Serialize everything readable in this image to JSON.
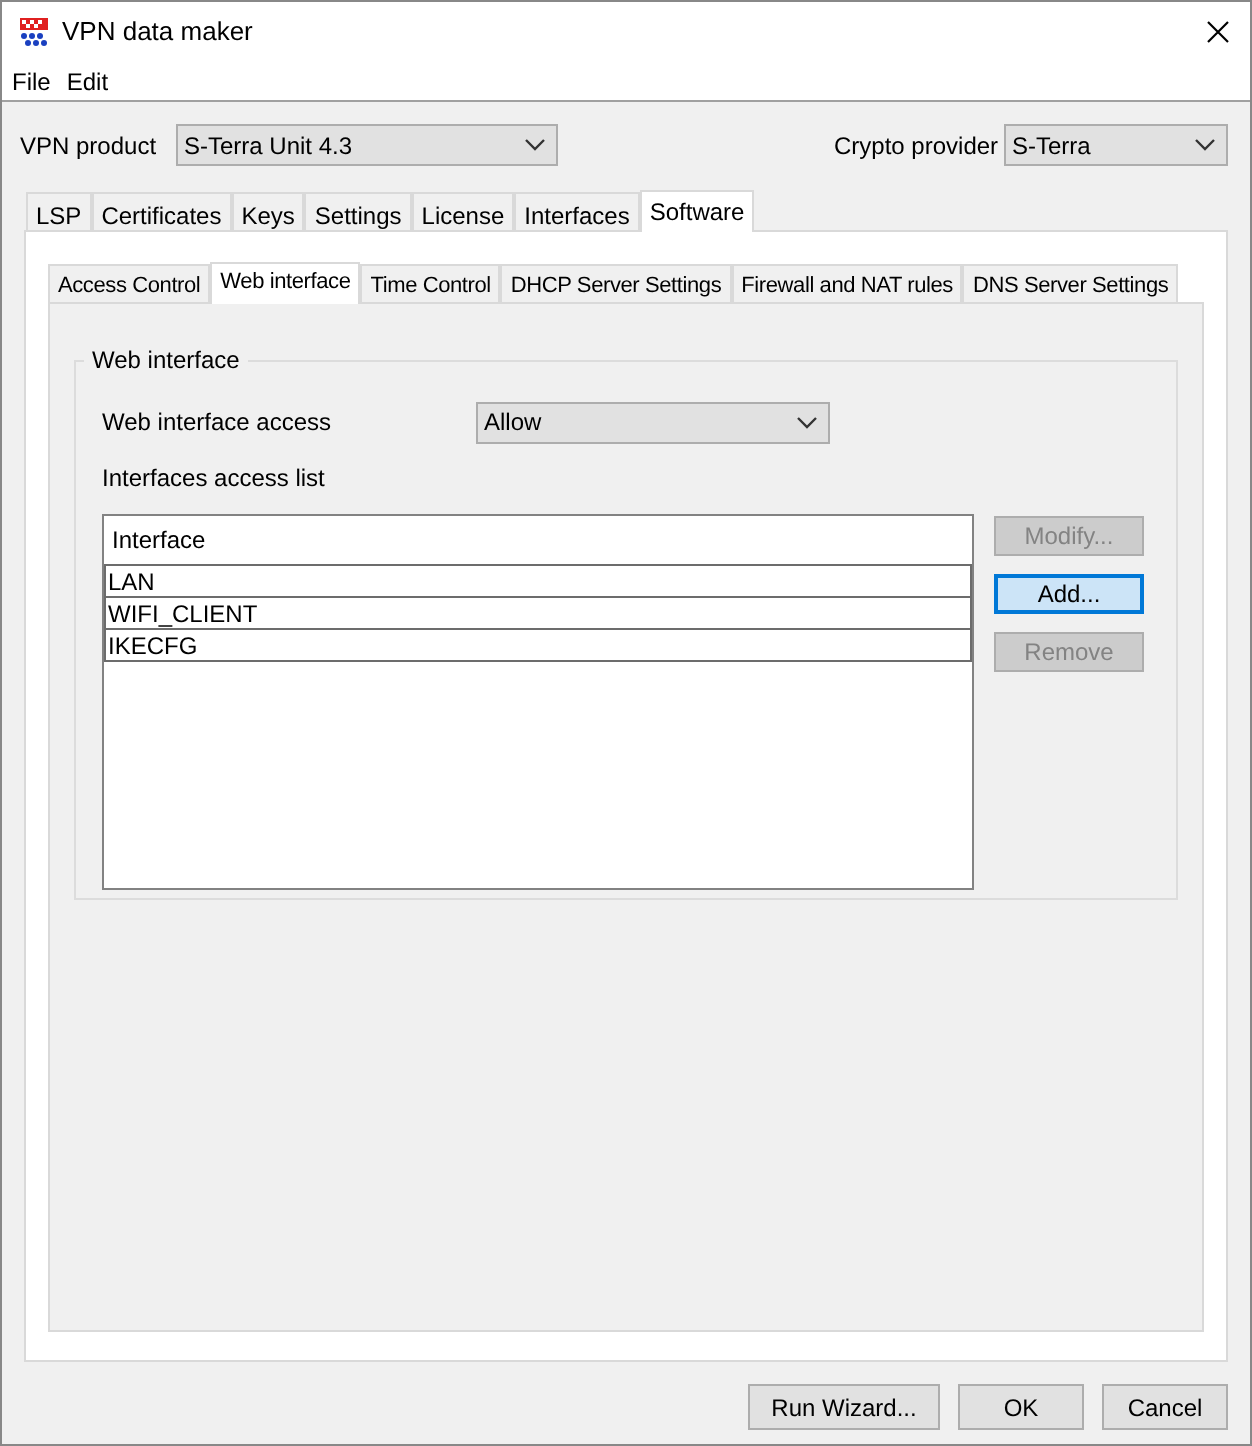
{
  "window": {
    "title": "VPN data maker"
  },
  "menu": [
    "File",
    "Edit"
  ],
  "vpn_product": {
    "label": "VPN product",
    "value": "S-Terra Unit 4.3"
  },
  "crypto_provider": {
    "label": "Crypto provider",
    "value": "S-Terra"
  },
  "tabs": [
    {
      "label": "LSP",
      "selected": false
    },
    {
      "label": "Certificates",
      "selected": false
    },
    {
      "label": "Keys",
      "selected": false
    },
    {
      "label": "Settings",
      "selected": false
    },
    {
      "label": "License",
      "selected": false
    },
    {
      "label": "Interfaces",
      "selected": false
    },
    {
      "label": "Software",
      "selected": true
    }
  ],
  "subtabs": [
    {
      "label": "Access Control",
      "selected": false
    },
    {
      "label": "Web interface",
      "selected": true
    },
    {
      "label": "Time Control",
      "selected": false
    },
    {
      "label": "DHCP Server Settings",
      "selected": false
    },
    {
      "label": "Firewall and NAT rules",
      "selected": false
    },
    {
      "label": "DNS Server Settings",
      "selected": false
    }
  ],
  "group": {
    "title": "Web interface",
    "access_label": "Web interface access",
    "access_value": "Allow",
    "list_label": "Interfaces access list",
    "table": {
      "columns": [
        "Interface"
      ],
      "rows": [
        "LAN",
        "WIFI_CLIENT",
        "IKECFG"
      ]
    },
    "buttons": [
      {
        "label": "Modify...",
        "disabled": true,
        "focused": false
      },
      {
        "label": "Add...",
        "disabled": false,
        "focused": true
      },
      {
        "label": "Remove",
        "disabled": true,
        "focused": false
      }
    ]
  },
  "footer_buttons": [
    "Run Wizard...",
    "OK",
    "Cancel"
  ]
}
